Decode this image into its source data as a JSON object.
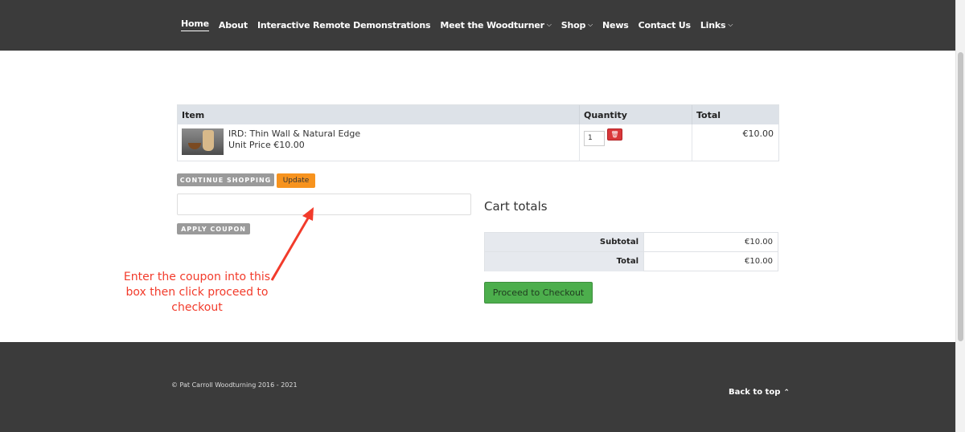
{
  "nav": {
    "items": [
      {
        "label": "Home",
        "has_dropdown": false,
        "active": true
      },
      {
        "label": "About",
        "has_dropdown": false
      },
      {
        "label": "Interactive Remote Demonstrations",
        "has_dropdown": false
      },
      {
        "label": "Meet the Woodturner",
        "has_dropdown": true
      },
      {
        "label": "Shop",
        "has_dropdown": true
      },
      {
        "label": "News",
        "has_dropdown": false
      },
      {
        "label": "Contact Us",
        "has_dropdown": false
      },
      {
        "label": "Links",
        "has_dropdown": true
      }
    ],
    "dropdown_glyph": "⌵"
  },
  "cart": {
    "headers": {
      "item": "Item",
      "quantity": "Quantity",
      "total": "Total"
    },
    "rows": [
      {
        "name": "IRD: Thin Wall & Natural Edge",
        "unit_price": "Unit Price €10.00",
        "quantity": "1",
        "total": "€10.00"
      }
    ],
    "delete_glyph": "🗑"
  },
  "buttons": {
    "continue_shopping": "Continue Shopping",
    "update": "Update",
    "apply_coupon": "Apply Coupon",
    "proceed_checkout": "Proceed to Checkout"
  },
  "annotation": "Enter the coupon into this box then click proceed to checkout",
  "totals": {
    "title": "Cart totals",
    "subtotal_label": "Subtotal",
    "subtotal_value": "€10.00",
    "total_label": "Total",
    "total_value": "€10.00"
  },
  "footer": {
    "copyright": "© Pat Carroll Woodturning 2016 - 2021",
    "back_to_top": "Back to top",
    "up_glyph": "⌃"
  },
  "colors": {
    "header_bg": "#3b3b3b",
    "annotation": "#f23b2b",
    "checkout": "#4cae4c",
    "update": "#f7931e",
    "delete": "#d9373a"
  }
}
